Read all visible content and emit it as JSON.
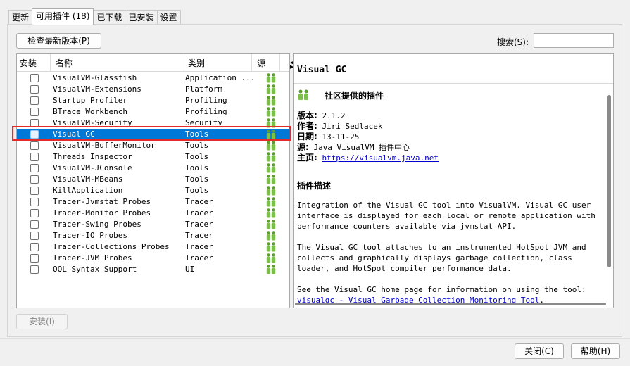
{
  "tabs": [
    {
      "label": "更新",
      "active": false
    },
    {
      "label": "可用插件 (18)",
      "active": true
    },
    {
      "label": "已下载",
      "active": false
    },
    {
      "label": "已安装",
      "active": false
    },
    {
      "label": "设置",
      "active": false
    }
  ],
  "toolbar": {
    "check_updates_label": "检查最新版本(P)",
    "search_label": "搜索(S):",
    "search_value": ""
  },
  "table": {
    "headers": {
      "install": "安装",
      "name": "名称",
      "category": "类别",
      "source": "源"
    },
    "rows": [
      {
        "name": "VisualVM-Glassfish",
        "category": "Application ...",
        "checked": false,
        "selected": false
      },
      {
        "name": "VisualVM-Extensions",
        "category": "Platform",
        "checked": false,
        "selected": false
      },
      {
        "name": "Startup Profiler",
        "category": "Profiling",
        "checked": false,
        "selected": false
      },
      {
        "name": "BTrace Workbench",
        "category": "Profiling",
        "checked": false,
        "selected": false
      },
      {
        "name": "VisualVM-Security",
        "category": "Security",
        "checked": false,
        "selected": false
      },
      {
        "name": "Visual GC",
        "category": "Tools",
        "checked": false,
        "selected": true
      },
      {
        "name": "VisualVM-BufferMonitor",
        "category": "Tools",
        "checked": false,
        "selected": false
      },
      {
        "name": "Threads Inspector",
        "category": "Tools",
        "checked": false,
        "selected": false
      },
      {
        "name": "VisualVM-JConsole",
        "category": "Tools",
        "checked": false,
        "selected": false
      },
      {
        "name": "VisualVM-MBeans",
        "category": "Tools",
        "checked": false,
        "selected": false
      },
      {
        "name": "KillApplication",
        "category": "Tools",
        "checked": false,
        "selected": false
      },
      {
        "name": "Tracer-Jvmstat Probes",
        "category": "Tracer",
        "checked": false,
        "selected": false
      },
      {
        "name": "Tracer-Monitor Probes",
        "category": "Tracer",
        "checked": false,
        "selected": false
      },
      {
        "name": "Tracer-Swing Probes",
        "category": "Tracer",
        "checked": false,
        "selected": false
      },
      {
        "name": "Tracer-IO Probes",
        "category": "Tracer",
        "checked": false,
        "selected": false
      },
      {
        "name": "Tracer-Collections Probes",
        "category": "Tracer",
        "checked": false,
        "selected": false
      },
      {
        "name": "Tracer-JVM Probes",
        "category": "Tracer",
        "checked": false,
        "selected": false
      },
      {
        "name": "OQL Syntax Support",
        "category": "UI",
        "checked": false,
        "selected": false
      }
    ],
    "source_icon": "community-plugin-icon"
  },
  "detail": {
    "title": "Visual GC",
    "community_label": "社区提供的插件",
    "version_key": "版本:",
    "version_value": "2.1.2",
    "author_key": "作者:",
    "author_value": "Jiri Sedlacek",
    "date_key": "日期:",
    "date_value": "13-11-25",
    "source_key": "源:",
    "source_value": "Java VisualVM 插件中心",
    "homepage_key": "主页:",
    "homepage_url": "https://visualvm.java.net",
    "desc_heading": "插件描述",
    "para1": "Integration of the Visual GC tool into VisualVM. Visual GC user interface is displayed for each local or remote application with performance counters available via jvmstat API.",
    "para2": "The Visual GC tool attaches to an instrumented HotSpot JVM and collects and graphically displays garbage collection, class loader, and HotSpot compiler performance data.",
    "para3_text": "See the Visual GC home page for information on using the tool: ",
    "para3_link": "visualgc - Visual Garbage Collection Monitoring Tool",
    "para3_end": "."
  },
  "buttons": {
    "install_label": "安装(I)",
    "close_label": "关闭(C)",
    "help_label": "帮助(H)"
  },
  "colors": {
    "selection": "#0078d7",
    "highlight_outline": "#e52a2a",
    "link": "#0000cc",
    "icon_green": "#5aa02c"
  }
}
